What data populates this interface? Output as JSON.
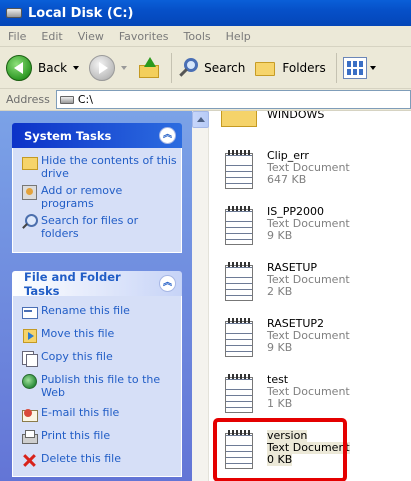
{
  "window": {
    "title": "Local Disk (C:)"
  },
  "menu": [
    "File",
    "Edit",
    "View",
    "Favorites",
    "Tools",
    "Help"
  ],
  "toolbar": {
    "back_label": "Back",
    "search_label": "Search",
    "folders_label": "Folders"
  },
  "address": {
    "label": "Address",
    "value": "C:\\"
  },
  "system_tasks": {
    "title": "System Tasks",
    "items": [
      {
        "label": "Hide the contents of this drive",
        "icon": "folder-icon"
      },
      {
        "label": "Add or remove programs",
        "icon": "add-remove-programs-icon"
      },
      {
        "label": "Search for files or folders",
        "icon": "search-icon"
      }
    ]
  },
  "file_folder_tasks": {
    "title": "File and Folder Tasks",
    "items": [
      {
        "label": "Rename this file",
        "icon": "rename-icon"
      },
      {
        "label": "Move this file",
        "icon": "move-icon"
      },
      {
        "label": "Copy this file",
        "icon": "copy-icon"
      },
      {
        "label": "Publish this file to the Web",
        "icon": "web-publish-icon"
      },
      {
        "label": "E-mail this file",
        "icon": "email-icon"
      },
      {
        "label": "Print this file",
        "icon": "print-icon"
      },
      {
        "label": "Delete this file",
        "icon": "delete-icon"
      }
    ]
  },
  "files": [
    {
      "name": "WINDOWS",
      "type": "",
      "size": ""
    },
    {
      "name": "Clip_err",
      "type": "Text Document",
      "size": "647 KB"
    },
    {
      "name": "IS_PP2000",
      "type": "Text Document",
      "size": "9 KB"
    },
    {
      "name": "RASETUP",
      "type": "Text Document",
      "size": "2 KB"
    },
    {
      "name": "RASETUP2",
      "type": "Text Document",
      "size": "9 KB"
    },
    {
      "name": "test",
      "type": "Text Document",
      "size": "1 KB"
    },
    {
      "name": "version",
      "type": "Text Document",
      "size": "0 KB"
    }
  ],
  "colors": {
    "highlight": "#e40000",
    "link": "#215dc6",
    "titlebar": "#0650c8"
  }
}
